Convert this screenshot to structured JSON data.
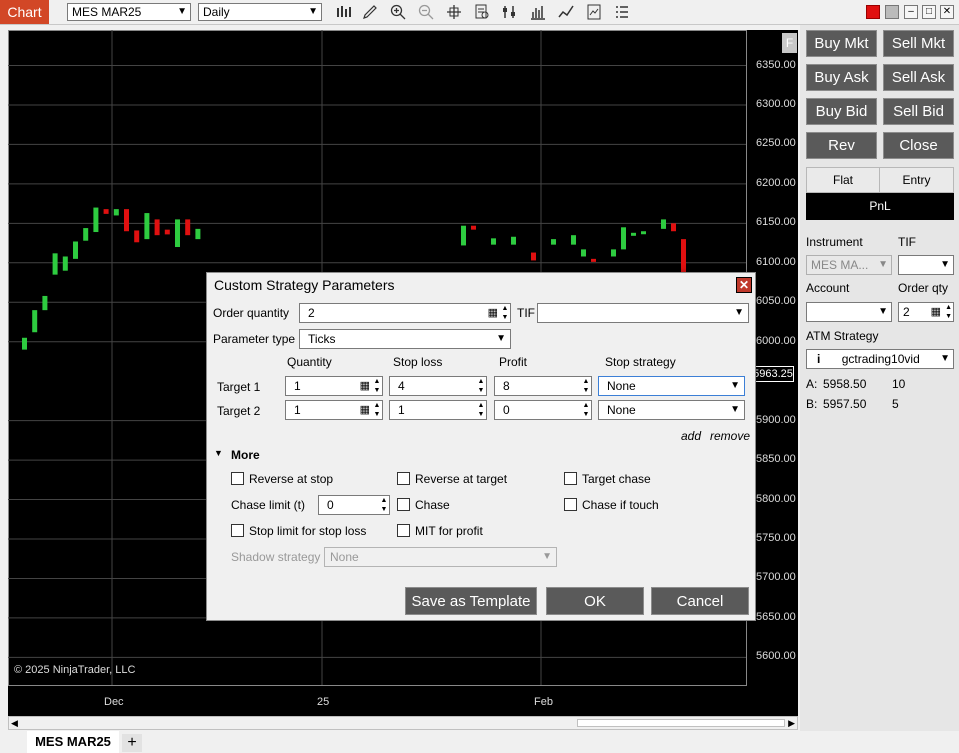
{
  "toolbar": {
    "chart_tab": "Chart",
    "instrument": "MES MAR25",
    "period": "Daily",
    "icons": [
      "bar-chart-icon",
      "pencil-icon",
      "zoom-in-icon",
      "zoom-out-icon",
      "crosshair-icon",
      "data-box-icon",
      "trade-icon",
      "volume-icon",
      "indicators-icon",
      "strategy-icon",
      "menu-icon"
    ]
  },
  "chart": {
    "f_button": "F",
    "price_marker": "5963.25",
    "copyright": "© 2025 NinjaTrader, LLC",
    "y_labels": [
      "6350.00",
      "6300.00",
      "6250.00",
      "6200.00",
      "6150.00",
      "6100.00",
      "6050.00",
      "6000.00",
      "5900.00",
      "5850.00",
      "5800.00",
      "5750.00",
      "5700.00",
      "5650.00",
      "5600.00"
    ],
    "x_labels": [
      "Dec",
      "25",
      "Feb"
    ],
    "bull_color": "#2ecc40",
    "bear_color": "#e01010"
  },
  "chart_data": {
    "type": "bar",
    "title": "MES MAR25 Daily",
    "bars": [
      {
        "o": 5990,
        "c": 6005,
        "dir": "up"
      },
      {
        "o": 6012,
        "c": 6040,
        "dir": "up"
      },
      {
        "o": 6040,
        "c": 6058,
        "dir": "up"
      },
      {
        "o": 6085,
        "c": 6112,
        "dir": "up"
      },
      {
        "o": 6090,
        "c": 6108,
        "dir": "up"
      },
      {
        "o": 6105,
        "c": 6127,
        "dir": "up"
      },
      {
        "o": 6128,
        "c": 6144,
        "dir": "up"
      },
      {
        "o": 6139,
        "c": 6170,
        "dir": "up"
      },
      {
        "o": 6162,
        "c": 6168,
        "dir": "down"
      },
      {
        "o": 6160,
        "c": 6168,
        "dir": "up"
      },
      {
        "o": 6168,
        "c": 6140,
        "dir": "down"
      },
      {
        "o": 6141,
        "c": 6126,
        "dir": "down"
      },
      {
        "o": 6130,
        "c": 6163,
        "dir": "up"
      },
      {
        "o": 6155,
        "c": 6135,
        "dir": "down"
      },
      {
        "o": 6142,
        "c": 6136,
        "dir": "down"
      },
      {
        "o": 6120,
        "c": 6155,
        "dir": "up"
      },
      {
        "o": 6155,
        "c": 6135,
        "dir": "down"
      },
      {
        "o": 6130,
        "c": 6143,
        "dir": "up"
      },
      {
        "o": 6122,
        "c": 6147,
        "dir": "up"
      },
      {
        "o": 6147,
        "c": 6142,
        "dir": "down"
      },
      {
        "o": 6123,
        "c": 6131,
        "dir": "up"
      },
      {
        "o": 6123,
        "c": 6133,
        "dir": "up"
      },
      {
        "o": 6113,
        "c": 6103,
        "dir": "down"
      },
      {
        "o": 6123,
        "c": 6130,
        "dir": "up"
      },
      {
        "o": 6123,
        "c": 6135,
        "dir": "up"
      },
      {
        "o": 6108,
        "c": 6117,
        "dir": "up"
      },
      {
        "o": 6105,
        "c": 6102,
        "dir": "down"
      },
      {
        "o": 6108,
        "c": 6117,
        "dir": "up"
      },
      {
        "o": 6117,
        "c": 6145,
        "dir": "up"
      },
      {
        "o": 6135,
        "c": 6138,
        "dir": "up"
      },
      {
        "o": 6140,
        "c": 6140,
        "dir": "up"
      },
      {
        "o": 6143,
        "c": 6155,
        "dir": "up"
      },
      {
        "o": 6150,
        "c": 6140,
        "dir": "down"
      },
      {
        "o": 6130,
        "c": 6080,
        "dir": "down"
      }
    ],
    "ylim": [
      5565,
      6395
    ],
    "xlabel": "",
    "ylabel": ""
  },
  "panel": {
    "buy_mkt": "Buy Mkt",
    "sell_mkt": "Sell Mkt",
    "buy_ask": "Buy Ask",
    "sell_ask": "Sell Ask",
    "buy_bid": "Buy Bid",
    "sell_bid": "Sell Bid",
    "rev": "Rev",
    "close": "Close",
    "flat": "Flat",
    "entry": "Entry",
    "pnl": "PnL",
    "instrument_label": "Instrument",
    "instrument_value": "MES MA...",
    "tif_label": "TIF",
    "tif_value": "",
    "account_label": "Account",
    "account_value": "",
    "order_qty_label": "Order qty",
    "order_qty_value": "2",
    "atm_label": "ATM Strategy",
    "atm_value": "gctrading10vid",
    "ask_label": "A:",
    "ask_price": "5958.50",
    "ask_size": "10",
    "bid_label": "B:",
    "bid_price": "5957.50",
    "bid_size": "5"
  },
  "dialog": {
    "title": "Custom Strategy Parameters",
    "order_qty_label": "Order quantity",
    "order_qty_value": "2",
    "tif_label": "TIF",
    "tif_value": "",
    "param_type_label": "Parameter type",
    "param_type_value": "Ticks",
    "col_quantity": "Quantity",
    "col_stop_loss": "Stop loss",
    "col_profit": "Profit",
    "col_stop_strategy": "Stop strategy",
    "targets": [
      {
        "label": "Target 1",
        "quantity": "1",
        "stop_loss": "4",
        "profit": "8",
        "stop_strategy": "None"
      },
      {
        "label": "Target 2",
        "quantity": "1",
        "stop_loss": "1",
        "profit": "0",
        "stop_strategy": "None"
      }
    ],
    "add": "add",
    "remove": "remove",
    "more": "More",
    "reverse_at_stop": "Reverse at stop",
    "reverse_at_target": "Reverse at target",
    "target_chase": "Target chase",
    "chase_limit_label": "Chase limit (t)",
    "chase_limit_value": "0",
    "chase": "Chase",
    "chase_if_touch": "Chase if touch",
    "stop_limit": "Stop limit for stop loss",
    "mit_profit": "MIT for profit",
    "shadow_label": "Shadow strategy",
    "shadow_value": "None",
    "save_template": "Save as Template",
    "ok": "OK",
    "cancel": "Cancel"
  },
  "bottom": {
    "tab": "MES MAR25",
    "add_tab": "+"
  }
}
